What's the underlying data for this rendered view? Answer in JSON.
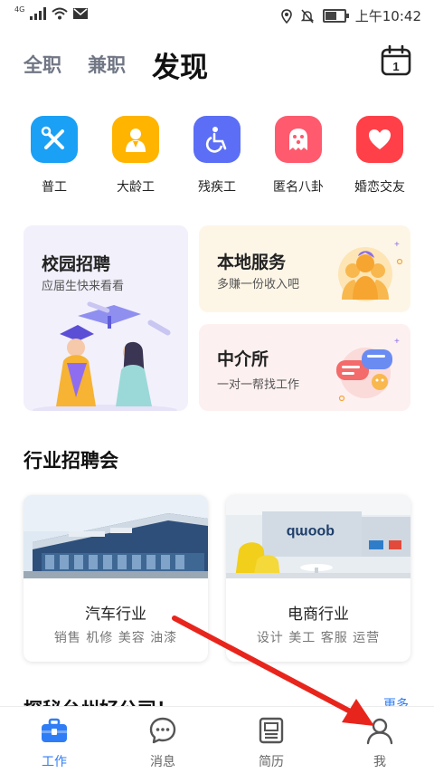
{
  "status_bar": {
    "network": "4G",
    "time": "上午10:42"
  },
  "header": {
    "tabs": [
      "全职",
      "兼职",
      "发现"
    ],
    "calendar_day": "1"
  },
  "categories": [
    {
      "label": "普工",
      "icon": "tools-icon",
      "color": "#1aa0f5"
    },
    {
      "label": "大龄工",
      "icon": "worker-icon",
      "color": "#ffb400"
    },
    {
      "label": "残疾工",
      "icon": "wheelchair-icon",
      "color": "#5b6ef5"
    },
    {
      "label": "匿名八卦",
      "icon": "ghost-icon",
      "color": "#ff5a6e"
    },
    {
      "label": "婚恋交友",
      "icon": "heart-icon",
      "color": "#ff4048"
    }
  ],
  "promos": {
    "campus": {
      "title": "校园招聘",
      "subtitle": "应届生快来看看"
    },
    "local": {
      "title": "本地服务",
      "subtitle": "多赚一份收入吧"
    },
    "agency": {
      "title": "中介所",
      "subtitle": "一对一帮找工作"
    }
  },
  "fairs": {
    "title": "行业招聘会",
    "items": [
      {
        "name": "汽车行业",
        "tags": "销售 机修 美容 油漆"
      },
      {
        "name": "电商行业",
        "tags": "设计 美工 客服 运营"
      }
    ]
  },
  "next_section": {
    "title": "探秘台州好公司！",
    "more": "更多"
  },
  "bottom_nav": [
    {
      "label": "工作",
      "icon": "briefcase-icon",
      "active": true
    },
    {
      "label": "消息",
      "icon": "chat-icon",
      "active": false
    },
    {
      "label": "简历",
      "icon": "resume-icon",
      "active": false
    },
    {
      "label": "我",
      "icon": "profile-icon",
      "active": false
    }
  ],
  "colors": {
    "accent": "#2f7df6",
    "annotation_arrow": "#e8251c"
  }
}
